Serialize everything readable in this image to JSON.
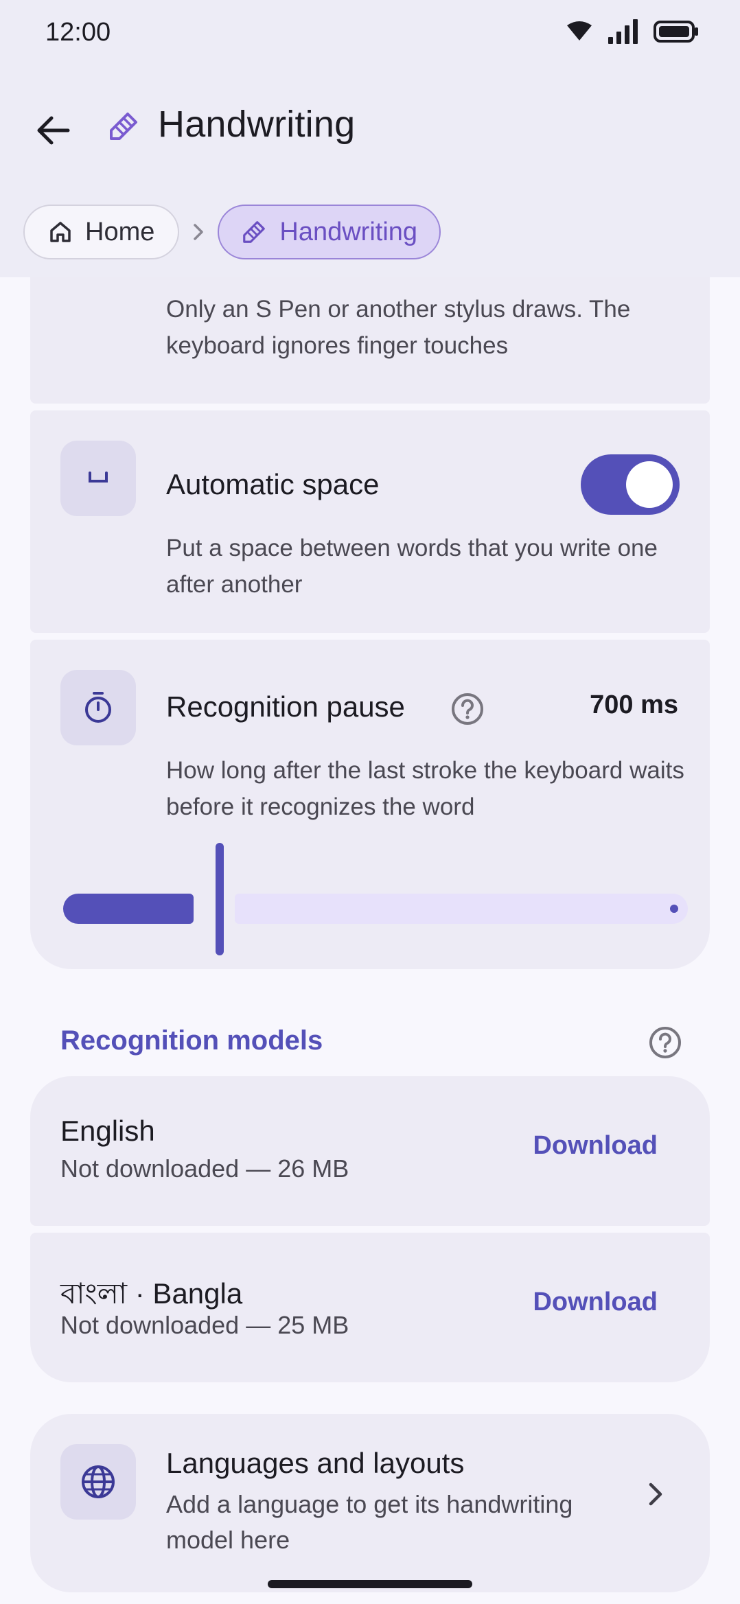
{
  "status_bar": {
    "time": "12:00",
    "icons": [
      "wifi-icon",
      "signal-icon",
      "battery-icon"
    ]
  },
  "app_bar": {
    "title": "Handwriting",
    "back_icon": "arrow-left-icon",
    "title_icon": "handwriting-pen-icon"
  },
  "breadcrumb": {
    "home_label": "Home",
    "current_label": "Handwriting"
  },
  "settings": {
    "stylus_only": {
      "description": "Only an S Pen or another stylus draws. The keyboard ignores finger touches"
    },
    "automatic_space": {
      "title": "Automatic space",
      "description": "Put a space between words that you write one after another",
      "enabled": true,
      "icon": "space-bar-icon"
    },
    "recognition_pause": {
      "title": "Recognition pause",
      "value": "700 ms",
      "description": "How long after the last stroke the keyboard waits before it recognizes the word",
      "slider_fraction": 0.24,
      "icon": "timer-icon"
    }
  },
  "recognition_models": {
    "header": "Recognition models",
    "items": [
      {
        "name": "English",
        "status": "Not downloaded — 26 MB",
        "action": "Download"
      },
      {
        "name": "বাংলা · Bangla",
        "status": "Not downloaded — 25 MB",
        "action": "Download"
      }
    ]
  },
  "languages": {
    "title": "Languages and layouts",
    "description": "Add a language to get its handwriting model here",
    "icon": "globe-icon"
  },
  "colors": {
    "accent": "#5450b8",
    "card": "#edebf5",
    "background": "#f8f7fd"
  }
}
